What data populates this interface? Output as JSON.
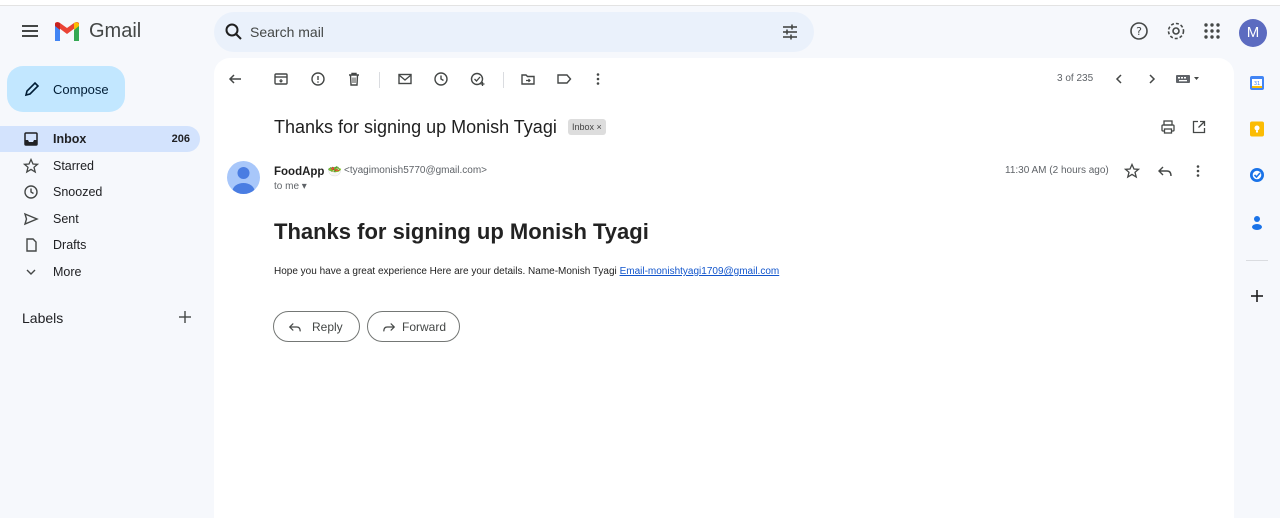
{
  "app": {
    "name": "Gmail"
  },
  "search": {
    "placeholder": "Search mail"
  },
  "user": {
    "initial": "M"
  },
  "compose": {
    "label": "Compose"
  },
  "nav": [
    {
      "label": "Inbox",
      "count": "206",
      "icon": "inbox-icon",
      "active": true
    },
    {
      "label": "Starred",
      "count": "",
      "icon": "star-icon"
    },
    {
      "label": "Snoozed",
      "count": "",
      "icon": "clock-icon"
    },
    {
      "label": "Sent",
      "count": "",
      "icon": "send-icon"
    },
    {
      "label": "Drafts",
      "count": "",
      "icon": "draft-icon"
    },
    {
      "label": "More",
      "count": "",
      "icon": "chevron-down-icon"
    }
  ],
  "labels": {
    "title": "Labels"
  },
  "toolbar": {
    "pager": "3 of 235"
  },
  "message": {
    "subject": "Thanks for signing up Monish Tyagi",
    "chip": "Inbox ×",
    "sender_name": "FoodApp 🥗",
    "sender_email": "<tyagimonish5770@gmail.com>",
    "to": "to me ▾",
    "time": "11:30 AM (2 hours ago)",
    "heading": "Thanks for signing up Monish Tyagi",
    "body": "Hope you have a great experience Here are your details. Name-Monish Tyagi ",
    "link": "Email-monishtyagi1709@gmail.com"
  },
  "actions": {
    "reply": "Reply",
    "forward": "Forward"
  },
  "colors": {
    "accent": "#c2e7ff",
    "active_nav": "#d3e3fd",
    "link": "#1155cc"
  }
}
